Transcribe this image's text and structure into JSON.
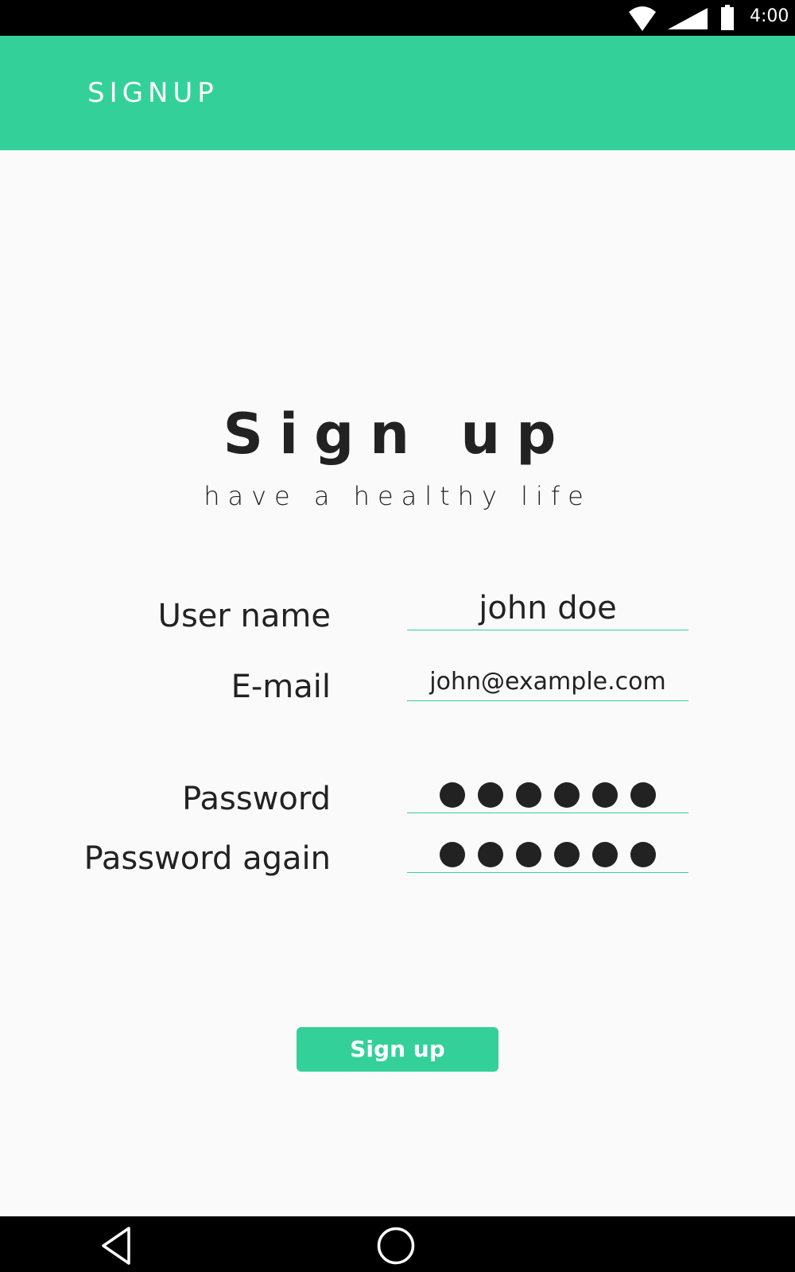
{
  "status_bar": {
    "time": "4:00",
    "icons": [
      "wifi-icon",
      "signal-icon",
      "battery-icon"
    ]
  },
  "app_bar": {
    "title": "SIGNUP",
    "background_color": "#34d09a"
  },
  "header": {
    "title": "Sign up",
    "subtitle": "have a healthy life"
  },
  "form": {
    "username": {
      "label": "User name",
      "value": "john doe"
    },
    "email": {
      "label": "E-mail",
      "value": "john@example.com"
    },
    "password": {
      "label": "Password",
      "masked_length": 6
    },
    "password_again": {
      "label": "Password again",
      "masked_length": 6
    }
  },
  "button": {
    "label": "Sign up",
    "color": "#34d09a"
  },
  "nav_bar": {
    "icons": [
      "back-icon",
      "home-icon"
    ]
  }
}
